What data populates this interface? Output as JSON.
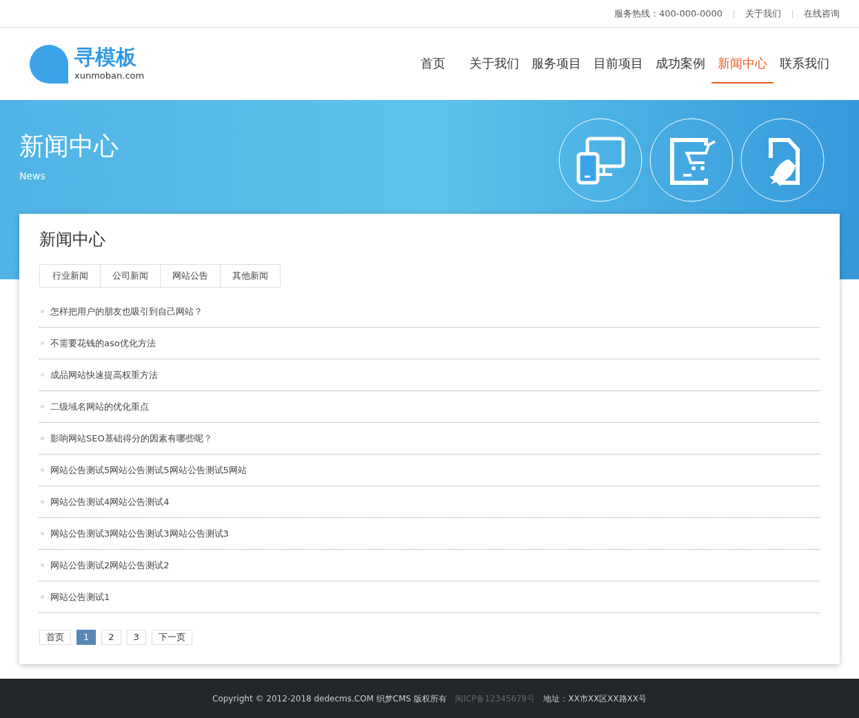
{
  "topbar": {
    "hotline": "服务热线：400-000-0000",
    "links": [
      "关于我们",
      "在线咨询"
    ]
  },
  "logo": {
    "name": "寻模板",
    "domain": "xunmoban.com"
  },
  "nav": [
    {
      "label": "首页",
      "selected": false
    },
    {
      "label": "关于我们",
      "selected": false
    },
    {
      "label": "服务项目",
      "selected": false
    },
    {
      "label": "目前项目",
      "selected": false
    },
    {
      "label": "成功案例",
      "selected": false
    },
    {
      "label": "新闻中心",
      "selected": true
    },
    {
      "label": "联系我们",
      "selected": false
    }
  ],
  "banner": {
    "title": "新闻中心",
    "subtitle": "News"
  },
  "section": {
    "title": "新闻中心"
  },
  "tabs": [
    "行业新闻",
    "公司新闻",
    "网站公告",
    "其他新闻"
  ],
  "articles": [
    "怎样把用户的朋友也吸引到自己网站？",
    "不需要花钱的aso优化方法",
    "成品网站快速提高权重方法",
    "二级域名网站的优化重点",
    "影响网站SEO基础得分的因素有哪些呢？",
    "网站公告测试5网站公告测试5网站公告测试5网站",
    "网站公告测试4网站公告测试4",
    "网站公告测试3网站公告测试3网站公告测试3",
    "网站公告测试2网站公告测试2",
    "网站公告测试1"
  ],
  "pagination": [
    {
      "label": "首页",
      "selected": false
    },
    {
      "label": "1",
      "selected": true
    },
    {
      "label": "2",
      "selected": false
    },
    {
      "label": "3",
      "selected": false
    },
    {
      "label": "下一页",
      "selected": false
    }
  ],
  "footer": {
    "copyright": "Copyright © 2012-2018 dedecms.COM 织梦CMS 版权所有",
    "icp": "闽ICP备12345678号",
    "address": "地址：XX市XX区XX路XX号"
  }
}
